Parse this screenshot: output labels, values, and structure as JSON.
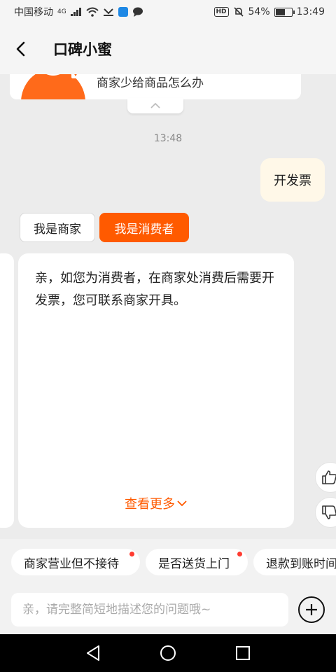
{
  "status_bar": {
    "carrier": "中国移动",
    "network": "4G",
    "battery_percent": "54%",
    "battery_level": 0.54,
    "time": "13:49",
    "hd_label": "HD"
  },
  "header": {
    "title": "口碑小蜜"
  },
  "chat": {
    "previous_card_text": "商家少给商品怎么办",
    "timestamp": "13:48",
    "user_message": "开发票",
    "option_merchant": "我是商家",
    "option_consumer": "我是消费者",
    "answer_text": "亲，如您为消费者，在商家处消费后需要开发票，您可联系商家开具。",
    "see_more": "查看更多"
  },
  "chips": [
    {
      "label": "商家营业但不接待",
      "has_dot": true
    },
    {
      "label": "是否送货上门",
      "has_dot": true
    },
    {
      "label": "退款到账时间",
      "has_dot": false
    }
  ],
  "input": {
    "placeholder": "亲，请完整简短地描述您的问题哦~"
  },
  "colors": {
    "accent": "#ff5a00",
    "user_bubble": "#fff8e8",
    "background": "#ececec"
  }
}
